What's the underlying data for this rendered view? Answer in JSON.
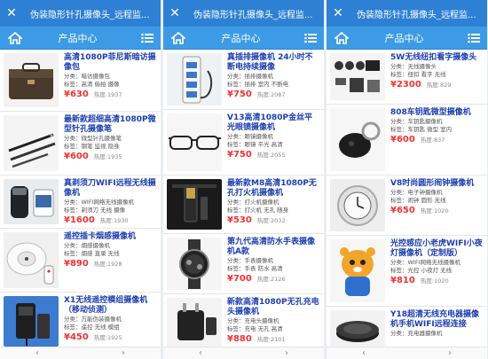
{
  "panels": [
    {
      "window_title": "伪装隐形针孔摄像头_远程监...",
      "header_title": "产品中心",
      "products": [
        {
          "name": "高清1080P菲尼斯暗访摄像包",
          "category": "分类：暗访摄像包",
          "tags": "标签：高清 偷拍 摄像",
          "price": "¥630",
          "hot": "热度:1937"
        },
        {
          "name": "最新款超细高清1080P微型针孔摄像笔",
          "category": "分类：微型针孔摄像笔",
          "tags": "标签：钢笔 监视 隐身",
          "price": "¥600",
          "hot": "热度:1935"
        },
        {
          "name": "真剃须刀WIFI远程无线摄像机",
          "category": "分类：WIFI网络无线摄像机",
          "tags": "标签：剃须刀 无线 摄像",
          "price": "¥1600",
          "hot": "热度:1930"
        },
        {
          "name": "遥控插卡烟感摄像机",
          "category": "分类：烟感摄像机",
          "tags": "标签：烟感 直录 无线",
          "price": "¥890",
          "hot": "热度:1928"
        },
        {
          "name": "X1无线遥控模组摄像机（移动侦测）",
          "category": "分类：万能伪装摄像机",
          "tags": "标签：遥控 无线 模组",
          "price": "¥450",
          "hot": "热度:1925"
        }
      ],
      "nav_back": "‹",
      "nav_forward": "›"
    },
    {
      "window_title": "伪装隐形针孔摄像头_远程监...",
      "header_title": "产品中心",
      "products": [
        {
          "name": "真插排摄像机 24小时不断电持续摄像",
          "category": "分类：插排摄像机",
          "tags": "标签：插排 室内 不断电",
          "price": "¥750",
          "hot": "热度:2087"
        },
        {
          "name": "V13高清1080P金丝平光眼镜摄像机",
          "category": "分类：眼镜摄像机",
          "tags": "标签：眼镜 平光 高清",
          "price": "¥750",
          "hot": "热度:2055"
        },
        {
          "name": "最新款M8高清1080P无孔打火机摄像机",
          "category": "分类：打火机摄像机",
          "tags": "标签：打火机 无孔 随身",
          "price": "¥530",
          "hot": "热度:2032"
        },
        {
          "name": "第九代高清防水手表摄像机A款",
          "category": "分类：手表摄像机",
          "tags": "标签：手表 防水 高清",
          "price": "¥700",
          "hot": "热度:2126"
        },
        {
          "name": "新款高清1080P无孔充电头摄像机",
          "category": "分类：充电头摄像机",
          "tags": "标签：充电 无孔 高清",
          "price": "¥880",
          "hot": "热度:2101"
        }
      ],
      "nav_back": "‹",
      "nav_forward": "›"
    },
    {
      "window_title": "伪装隐形针孔摄像头_远程监...",
      "header_title": "产品中心",
      "products": [
        {
          "name": "5W无线纽扣看字摄像头",
          "category": "分类：无线摄像头",
          "tags": "标签：纽扣 看字 无线",
          "price": "¥2300",
          "hot": "热度:829"
        },
        {
          "name": "808车钥匙微型摄像机",
          "category": "分类：车钥匙摄像机",
          "tags": "标签：车钥匙 微型 室内",
          "price": "¥600",
          "hot": "热度:837"
        },
        {
          "name": "V8时尚圆形闹钟摄像机",
          "category": "分类：电子钟摄像机",
          "tags": "标签：闹钟 圆形 无线",
          "price": "¥650",
          "hot": "热度:1020"
        },
        {
          "name": "光控感应小老虎WIFI小夜灯摄像机（定制版）",
          "category": "分类：WIFI网络无线摄像机",
          "tags": "标签：光控 小夜灯 无线",
          "price": "¥810",
          "hot": "热度:1020"
        },
        {
          "name": "Y18超清无线充电器摄像机手机WIFI远程连接",
          "category": "分类：充电器摄像机",
          "tags": "标签：无线 充电 远程",
          "price": "",
          "hot": ""
        }
      ],
      "nav_back": "‹",
      "nav_forward": "›"
    }
  ]
}
